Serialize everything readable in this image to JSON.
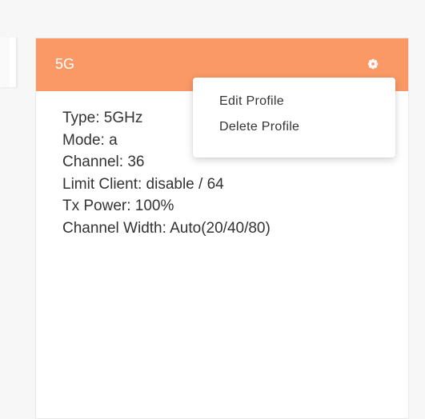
{
  "card": {
    "title": "5G",
    "header_color": "#fa9966",
    "details": [
      "Type: 5GHz",
      "Mode: a",
      "Channel: 36",
      "Limit Client: disable / 64",
      "Tx Power: 100%",
      "Channel Width: Auto(20/40/80)"
    ],
    "settings_icon": "gear-icon"
  },
  "menu": {
    "items": [
      "Edit Profile",
      "Delete Profile"
    ]
  }
}
